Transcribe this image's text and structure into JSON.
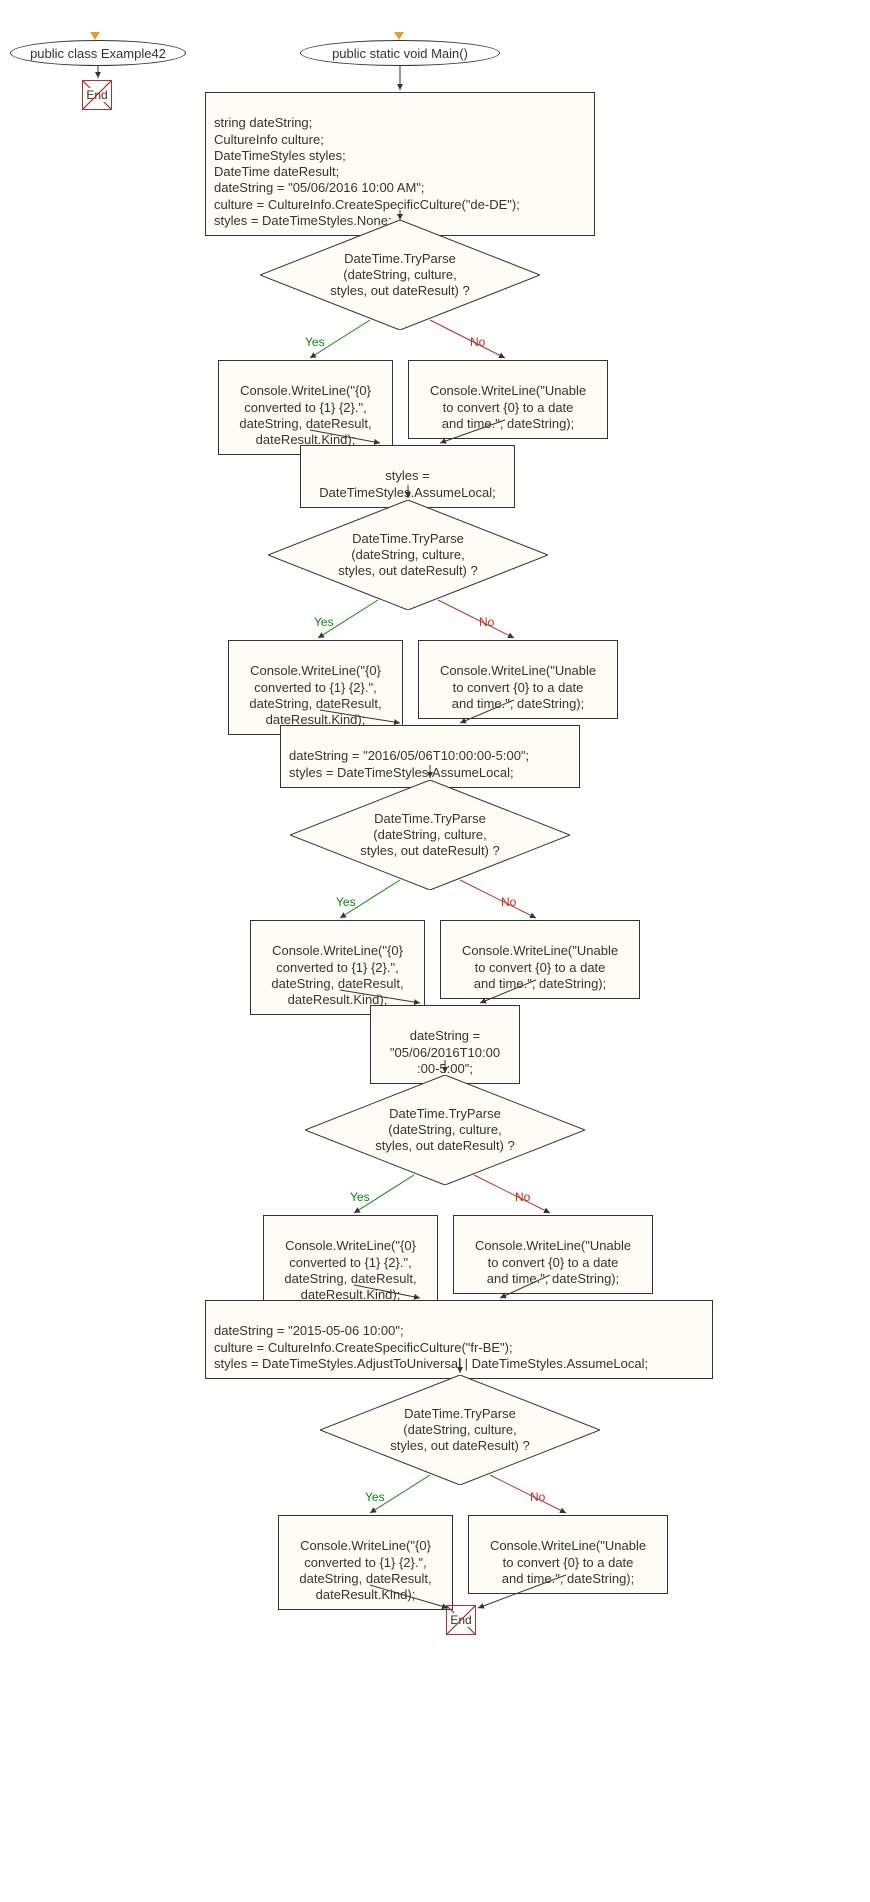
{
  "terminals": {
    "class": "public class Example42",
    "main": "public static void Main()",
    "end": "End"
  },
  "blocks": {
    "b1": "string dateString;\nCultureInfo culture;\nDateTimeStyles styles;\nDateTime dateResult;\ndateString = \"05/06/2016 10:00 AM\";\nculture = CultureInfo.CreateSpecificCulture(\"de-DE\");\nstyles = DateTimeStyles.None;",
    "b2": "styles =\nDateTimeStyles.AssumeLocal;",
    "b3": "dateString = \"2016/05/06T10:00:00-5:00\";\nstyles = DateTimeStyles.AssumeLocal;",
    "b4": "dateString =\n\"05/06/2016T10:00\n:00-5:00\";",
    "b5": "dateString = \"2015-05-06 10:00\";\nculture = CultureInfo.CreateSpecificCulture(\"fr-BE\");\nstyles = DateTimeStyles.AdjustToUniversal | DateTimeStyles.AssumeLocal;"
  },
  "decision": "DateTime.TryParse\n(dateString, culture,\nstyles, out dateResult) ?",
  "yesbox": "Console.WriteLine(\"{0}\nconverted to {1} {2}.\",\ndateString, dateResult,\ndateResult.Kind);",
  "nobox": "Console.WriteLine(\"Unable\nto convert {0} to a date\nand time.\", dateString);",
  "labels": {
    "yes": "Yes",
    "no": "No"
  },
  "chart_data": {
    "type": "flowchart",
    "title": "",
    "nodes": [
      {
        "id": "class",
        "shape": "ellipse",
        "label": "public class Example42"
      },
      {
        "id": "end1",
        "shape": "terminator",
        "label": "End"
      },
      {
        "id": "main",
        "shape": "ellipse",
        "label": "public static void Main()"
      },
      {
        "id": "b1",
        "shape": "rect",
        "label": "string dateString; CultureInfo culture; DateTimeStyles styles; DateTime dateResult; dateString = \"05/06/2016 10:00 AM\"; culture = CultureInfo.CreateSpecificCulture(\"de-DE\"); styles = DateTimeStyles.None;"
      },
      {
        "id": "d1",
        "shape": "diamond",
        "label": "DateTime.TryParse(dateString, culture, styles, out dateResult) ?"
      },
      {
        "id": "y1",
        "shape": "rect",
        "label": "Console.WriteLine(\"{0} converted to {1} {2}.\", dateString, dateResult, dateResult.Kind);"
      },
      {
        "id": "n1",
        "shape": "rect",
        "label": "Console.WriteLine(\"Unable to convert {0} to a date and time.\", dateString);"
      },
      {
        "id": "b2",
        "shape": "rect",
        "label": "styles = DateTimeStyles.AssumeLocal;"
      },
      {
        "id": "d2",
        "shape": "diamond",
        "label": "DateTime.TryParse(dateString, culture, styles, out dateResult) ?"
      },
      {
        "id": "y2",
        "shape": "rect",
        "label": "Console.WriteLine(\"{0} converted to {1} {2}.\", dateString, dateResult, dateResult.Kind);"
      },
      {
        "id": "n2",
        "shape": "rect",
        "label": "Console.WriteLine(\"Unable to convert {0} to a date and time.\", dateString);"
      },
      {
        "id": "b3",
        "shape": "rect",
        "label": "dateString = \"2016/05/06T10:00:00-5:00\"; styles = DateTimeStyles.AssumeLocal;"
      },
      {
        "id": "d3",
        "shape": "diamond",
        "label": "DateTime.TryParse(dateString, culture, styles, out dateResult) ?"
      },
      {
        "id": "y3",
        "shape": "rect",
        "label": "Console.WriteLine(\"{0} converted to {1} {2}.\", dateString, dateResult, dateResult.Kind);"
      },
      {
        "id": "n3",
        "shape": "rect",
        "label": "Console.WriteLine(\"Unable to convert {0} to a date and time.\", dateString);"
      },
      {
        "id": "b4",
        "shape": "rect",
        "label": "dateString = \"05/06/2016T10:00:00-5:00\";"
      },
      {
        "id": "d4",
        "shape": "diamond",
        "label": "DateTime.TryParse(dateString, culture, styles, out dateResult) ?"
      },
      {
        "id": "y4",
        "shape": "rect",
        "label": "Console.WriteLine(\"{0} converted to {1} {2}.\", dateString, dateResult, dateResult.Kind);"
      },
      {
        "id": "n4",
        "shape": "rect",
        "label": "Console.WriteLine(\"Unable to convert {0} to a date and time.\", dateString);"
      },
      {
        "id": "b5",
        "shape": "rect",
        "label": "dateString = \"2015-05-06 10:00\"; culture = CultureInfo.CreateSpecificCulture(\"fr-BE\"); styles = DateTimeStyles.AdjustToUniversal | DateTimeStyles.AssumeLocal;"
      },
      {
        "id": "d5",
        "shape": "diamond",
        "label": "DateTime.TryParse(dateString, culture, styles, out dateResult) ?"
      },
      {
        "id": "y5",
        "shape": "rect",
        "label": "Console.WriteLine(\"{0} converted to {1} {2}.\", dateString, dateResult, dateResult.Kind);"
      },
      {
        "id": "n5",
        "shape": "rect",
        "label": "Console.WriteLine(\"Unable to convert {0} to a date and time.\", dateString);"
      },
      {
        "id": "end2",
        "shape": "terminator",
        "label": "End"
      }
    ],
    "edges": [
      {
        "from": "class",
        "to": "end1"
      },
      {
        "from": "main",
        "to": "b1"
      },
      {
        "from": "b1",
        "to": "d1"
      },
      {
        "from": "d1",
        "to": "y1",
        "label": "Yes"
      },
      {
        "from": "d1",
        "to": "n1",
        "label": "No"
      },
      {
        "from": "y1",
        "to": "b2"
      },
      {
        "from": "n1",
        "to": "b2"
      },
      {
        "from": "b2",
        "to": "d2"
      },
      {
        "from": "d2",
        "to": "y2",
        "label": "Yes"
      },
      {
        "from": "d2",
        "to": "n2",
        "label": "No"
      },
      {
        "from": "y2",
        "to": "b3"
      },
      {
        "from": "n2",
        "to": "b3"
      },
      {
        "from": "b3",
        "to": "d3"
      },
      {
        "from": "d3",
        "to": "y3",
        "label": "Yes"
      },
      {
        "from": "d3",
        "to": "n3",
        "label": "No"
      },
      {
        "from": "y3",
        "to": "b4"
      },
      {
        "from": "n3",
        "to": "b4"
      },
      {
        "from": "b4",
        "to": "d4"
      },
      {
        "from": "d4",
        "to": "y4",
        "label": "Yes"
      },
      {
        "from": "d4",
        "to": "n4",
        "label": "No"
      },
      {
        "from": "y4",
        "to": "b5"
      },
      {
        "from": "n4",
        "to": "b5"
      },
      {
        "from": "b5",
        "to": "d5"
      },
      {
        "from": "d5",
        "to": "y5",
        "label": "Yes"
      },
      {
        "from": "d5",
        "to": "n5",
        "label": "No"
      },
      {
        "from": "y5",
        "to": "end2"
      },
      {
        "from": "n5",
        "to": "end2"
      }
    ]
  }
}
